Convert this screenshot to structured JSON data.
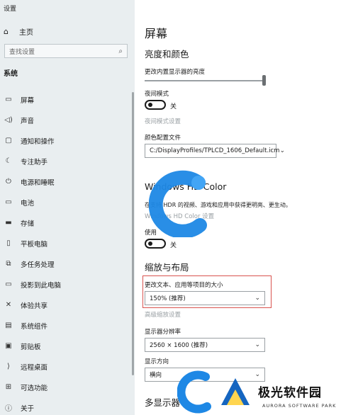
{
  "app": {
    "title": "设置"
  },
  "sidebar": {
    "home_label": "主页",
    "search_placeholder": "查找设置",
    "section_label": "系统",
    "items": [
      {
        "label": "屏幕",
        "icon": "monitor-icon"
      },
      {
        "label": "声音",
        "icon": "speaker-icon"
      },
      {
        "label": "通知和操作",
        "icon": "notification-icon"
      },
      {
        "label": "专注助手",
        "icon": "moon-icon"
      },
      {
        "label": "电源和睡眠",
        "icon": "power-icon"
      },
      {
        "label": "电池",
        "icon": "battery-icon"
      },
      {
        "label": "存储",
        "icon": "storage-icon"
      },
      {
        "label": "平板电脑",
        "icon": "tablet-icon"
      },
      {
        "label": "多任务处理",
        "icon": "multitask-icon"
      },
      {
        "label": "投影到此电脑",
        "icon": "projection-icon"
      },
      {
        "label": "体验共享",
        "icon": "share-icon"
      },
      {
        "label": "系统组件",
        "icon": "components-icon"
      },
      {
        "label": "剪贴板",
        "icon": "clipboard-icon"
      },
      {
        "label": "远程桌面",
        "icon": "remote-desktop-icon"
      },
      {
        "label": "可选功能",
        "icon": "optional-features-icon"
      },
      {
        "label": "关于",
        "icon": "info-icon"
      }
    ]
  },
  "main": {
    "title": "屏幕",
    "brightness_section": "亮度和颜色",
    "brightness_label": "更改内置显示器的亮度",
    "brightness_value": 1.0,
    "night_light_label": "夜间模式",
    "night_light_state": "关",
    "night_light_settings_link": "夜间模式设置",
    "color_profile_label": "颜色配置文件",
    "color_profile_value": "C:/DisplayProfiles/TPLCD_1606_Default.icm",
    "hdr_section": "Windows HD Color",
    "hdr_desc": "在支持 HDR 的视频、游戏和应用中获得更明亮、更生动。",
    "hdr_link": "Windows HD Color 设置",
    "hdr_toggle_label": "使用",
    "hdr_toggle_state": "关",
    "scale_section": "缩放与布局",
    "scale_label": "更改文本、应用等项目的大小",
    "scale_value": "150% (推荐)",
    "advanced_scaling_link": "高级缩放设置",
    "resolution_label": "显示器分辨率",
    "resolution_value": "2560 × 1600 (推荐)",
    "orientation_label": "显示方向",
    "orientation_value": "横向",
    "multi_display_section": "多显示器"
  },
  "watermark": {
    "brand_name": "极光软件园",
    "brand_sub": "AURORA SOFTWARE PARK"
  },
  "colors": {
    "sidebar_bg": "#e9eef0",
    "highlight_border": "#d9534f",
    "watermark_blue": "#1e88e5"
  }
}
